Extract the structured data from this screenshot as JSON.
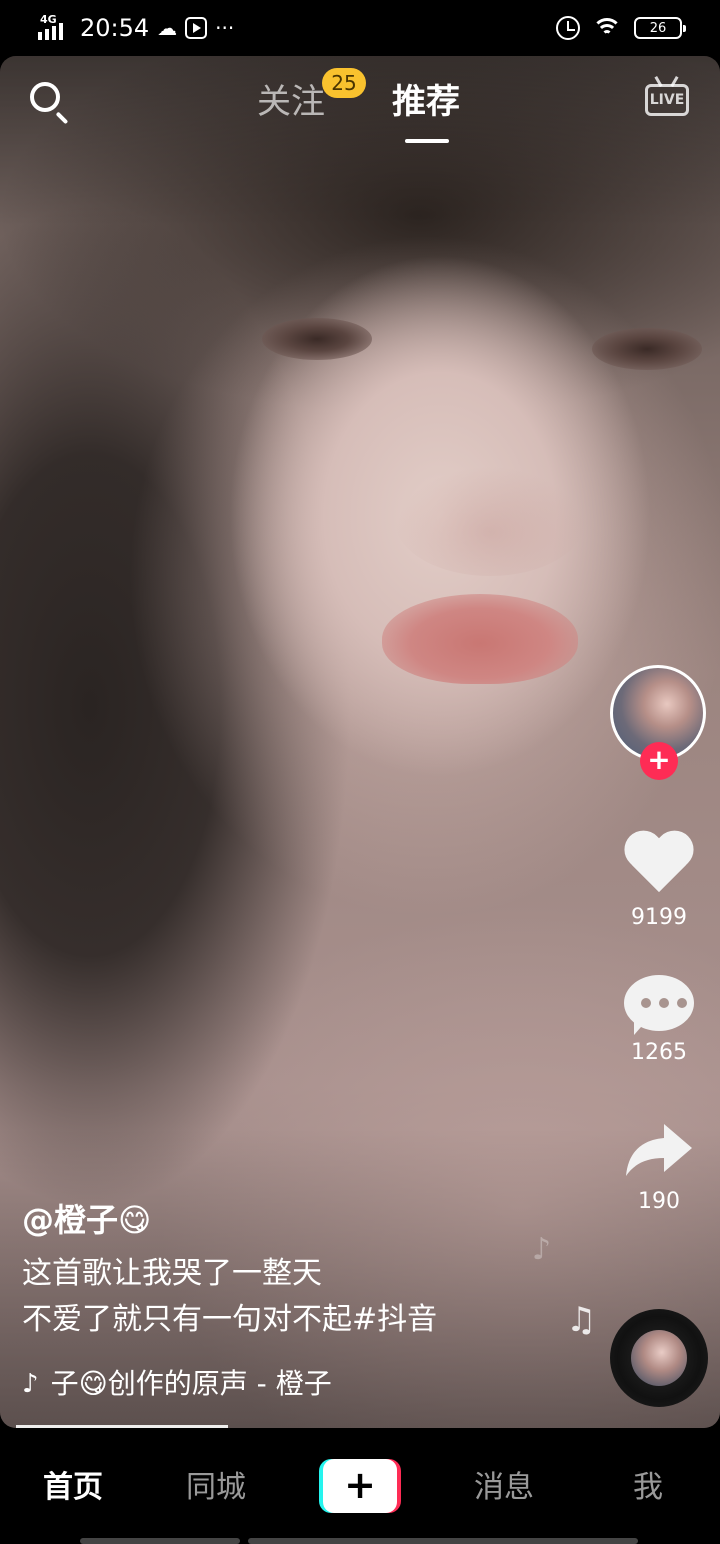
{
  "status_bar": {
    "network": "4G",
    "time": "20:54",
    "more": "···",
    "battery": "26"
  },
  "top_nav": {
    "follow_tab": "关注",
    "follow_badge": "25",
    "recommend_tab": "推荐",
    "live_icon_text": "LIVE"
  },
  "actions": {
    "likes": "9199",
    "comments": "1265",
    "shares": "190"
  },
  "post": {
    "author": "@橙子😋",
    "caption_line1": "这首歌让我哭了一整天",
    "caption_line2": "不爱了就只有一句对不起#抖音",
    "music": "子😋创作的原声 - 橙子"
  },
  "bottom_nav": {
    "home": "首页",
    "nearby": "同城",
    "create": "+",
    "messages": "消息",
    "me": "我"
  },
  "colors": {
    "accent_red": "#fe2c55",
    "accent_cyan": "#25f4ee",
    "badge_yellow": "#f9c22e"
  }
}
